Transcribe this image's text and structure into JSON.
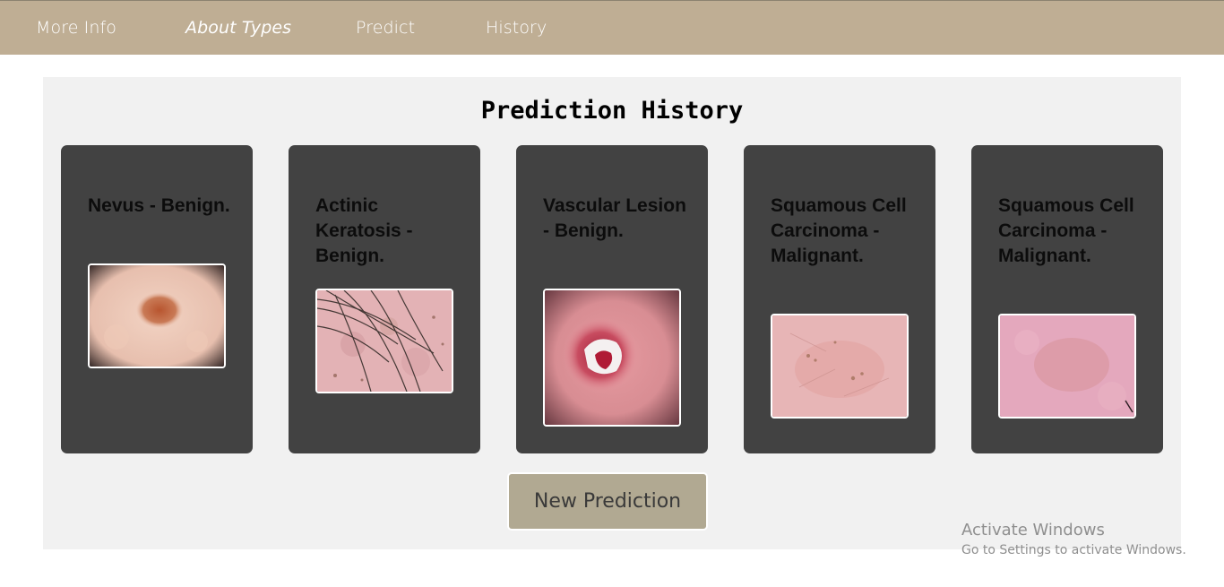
{
  "nav": {
    "items": [
      {
        "label": "More Info"
      },
      {
        "label": "About Types"
      },
      {
        "label": "Predict"
      },
      {
        "label": "History"
      }
    ]
  },
  "history": {
    "title": "Prediction History",
    "cards": [
      {
        "label": "Nevus - Benign."
      },
      {
        "label": "Actinic Keratosis - Benign."
      },
      {
        "label": "Vascular Lesion - Benign."
      },
      {
        "label": "Squamous Cell Carcinoma - Malignant."
      },
      {
        "label": "Squamous Cell Carcinoma - Malignant."
      }
    ],
    "new_prediction_label": "New Prediction"
  },
  "watermark": {
    "line1": "Activate Windows",
    "line2": "Go to Settings to activate Windows."
  },
  "colors": {
    "nav_bg": "#bfae94",
    "card_bg": "#424242",
    "panel_bg": "#f1f1f1",
    "button_bg": "#b1a992"
  }
}
